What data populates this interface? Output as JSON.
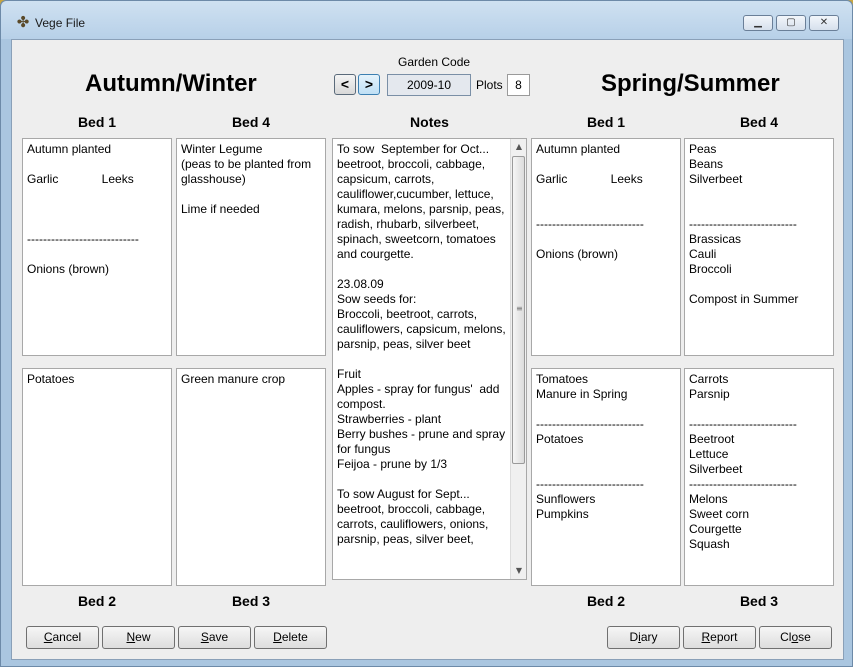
{
  "window": {
    "title": "Vege File",
    "controls": {
      "minimize": "▁",
      "maximize": "▢",
      "close": "✕"
    }
  },
  "header": {
    "left_title": "Autumn/Winter",
    "right_title": "Spring/Summer",
    "garden_code_label": "Garden Code",
    "prev": "<",
    "next": ">",
    "garden_code_value": "2009-10",
    "plots_label": "Plots",
    "plots_value": "8"
  },
  "columns": {
    "aw_bed1": "Bed 1",
    "aw_bed4": "Bed 4",
    "notes": "Notes",
    "ss_bed1": "Bed 1",
    "ss_bed4": "Bed 4",
    "aw_bed2": "Bed 2",
    "aw_bed3": "Bed 3",
    "ss_bed2": "Bed 2",
    "ss_bed3": "Bed 3"
  },
  "beds": {
    "aw_bed1": "Autumn planted\n\nGarlic             Leeks\n\n\n\n----------------------------\n\nOnions (brown)",
    "aw_bed4": "Winter Legume\n(peas to be planted from glasshouse)\n\nLime if needed",
    "aw_bed2": "Potatoes",
    "aw_bed3": "Green manure crop",
    "ss_bed1": "Autumn planted\n\nGarlic             Leeks\n\n\n---------------------------\n\nOnions (brown)",
    "ss_bed4": "Peas\nBeans\nSilverbeet\n\n\n---------------------------\nBrassicas\nCauli\nBroccoli\n\nCompost in Summer",
    "ss_bed2": "Tomatoes\nManure in Spring\n\n---------------------------\nPotatoes\n\n\n---------------------------\nSunflowers\nPumpkins",
    "ss_bed3": "Carrots\nParsnip\n\n---------------------------\nBeetroot\nLettuce\nSilverbeet\n---------------------------\nMelons\nSweet corn\nCourgette\nSquash"
  },
  "notes_text": "To sow  September for Oct...\nbeetroot, broccoli, cabbage, capsicum, carrots, cauliflower,cucumber, lettuce, kumara, melons, parsnip, peas, radish, rhubarb, silverbeet, spinach, sweetcorn, tomatoes and courgette.\n\n23.08.09\nSow seeds for:\nBroccoli, beetroot, carrots, cauliflowers, capsicum, melons, parsnip, peas, silver beet\n\nFruit\nApples - spray for fungus'  add compost.\nStrawberries - plant\nBerry bushes - prune and spray for fungus\nFeijoa - prune by 1/3\n\nTo sow August for Sept...\nbeetroot, broccoli, cabbage, carrots, cauliflowers, onions, parsnip, peas, silver beet,",
  "buttons": {
    "cancel_mn": "C",
    "cancel_rest": "ancel",
    "new_mn": "N",
    "new_rest": "ew",
    "save_mn": "S",
    "save_rest": "ave",
    "delete_mn": "D",
    "delete_rest": "elete",
    "diary_pre": "D",
    "diary_mn": "i",
    "diary_rest": "ary",
    "report_mn": "R",
    "report_rest": "eport",
    "close_pre": "Cl",
    "close_mn": "o",
    "close_rest": "se"
  }
}
